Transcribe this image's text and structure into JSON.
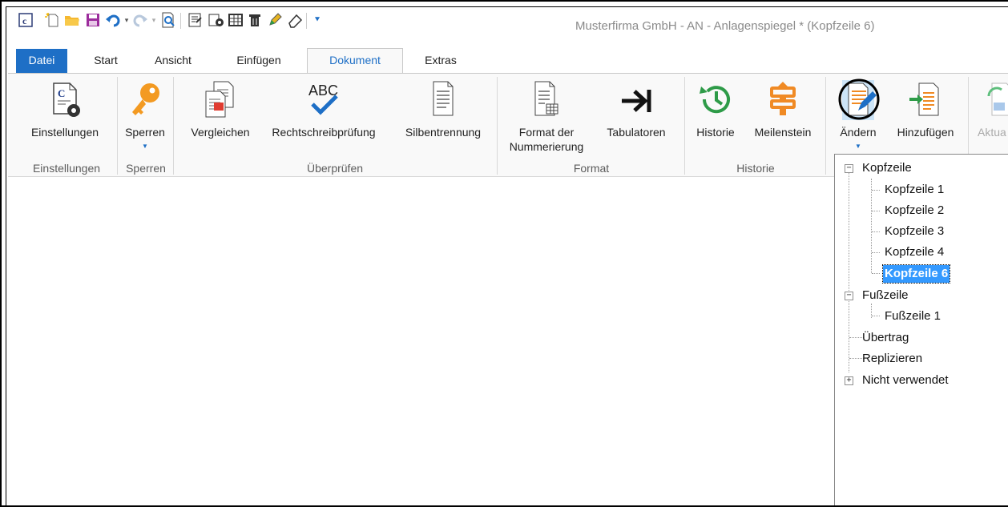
{
  "window": {
    "title": "Musterfirma GmbH - AN - Anlagenspiegel * (Kopfzeile 6)"
  },
  "quick_access": [
    {
      "icon": "app-icon"
    },
    {
      "icon": "new-document-icon"
    },
    {
      "icon": "open-folder-icon"
    },
    {
      "icon": "save-icon"
    },
    {
      "icon": "undo-icon"
    },
    {
      "icon": "redo-icon"
    },
    {
      "icon": "print-preview-icon"
    },
    {
      "icon": "export-icon"
    },
    {
      "icon": "settings-icon"
    },
    {
      "icon": "table-icon"
    },
    {
      "icon": "delete-icon"
    },
    {
      "icon": "pen-icon"
    },
    {
      "icon": "eraser-icon"
    },
    {
      "icon": "customize-icon"
    }
  ],
  "tabs": {
    "file": "Datei",
    "start": "Start",
    "ansicht": "Ansicht",
    "einfuegen": "Einfügen",
    "dokument": "Dokument",
    "extras": "Extras"
  },
  "ribbon": {
    "buttons": {
      "einstellungen": "Einstellungen",
      "sperren": "Sperren",
      "vergleichen": "Vergleichen",
      "rechtschreib": "Rechtschreibprüfung",
      "silben": "Silbentrennung",
      "format_line1": "Format der",
      "format_line2": "Nummerierung",
      "tabulatoren": "Tabulatoren",
      "historie": "Historie",
      "meilenstein": "Meilenstein",
      "aendern": "Ändern",
      "hinzufuegen": "Hinzufügen",
      "aktualisieren": "Aktua"
    },
    "groups": {
      "einstellungen": "Einstellungen",
      "sperren": "Sperren",
      "ueberpruefen": "Überprüfen",
      "format": "Format",
      "historie": "Historie"
    },
    "abc_text": "ABC"
  },
  "tree": {
    "kopfzeile": "Kopfzeile",
    "kopfzeile_items": [
      "Kopfzeile 1",
      "Kopfzeile 2",
      "Kopfzeile 3",
      "Kopfzeile 4",
      "Kopfzeile 6"
    ],
    "fusszeile": "Fußzeile",
    "fusszeile_items": [
      "Fußzeile 1"
    ],
    "uebertrag": "Übertrag",
    "replizieren": "Replizieren",
    "nicht_verwendet": "Nicht verwendet",
    "selected": "Kopfzeile 6"
  },
  "colors": {
    "accent": "#1e6fc6",
    "orange": "#f08a24",
    "green": "#2e9b48",
    "selection": "#3399ff"
  }
}
